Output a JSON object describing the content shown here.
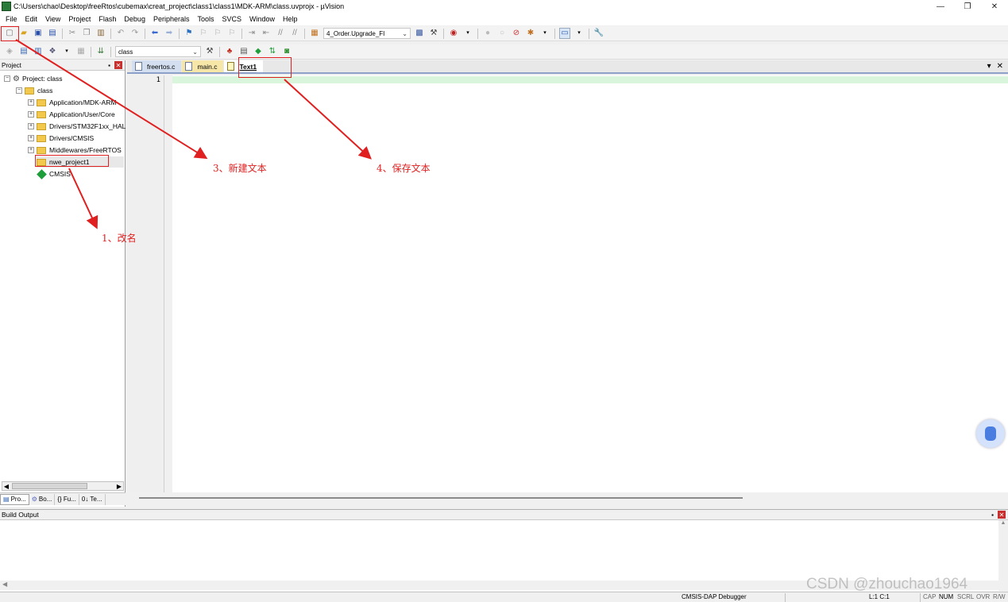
{
  "window": {
    "title": "C:\\Users\\chao\\Desktop\\freeRtos\\cubemax\\creat_project\\class1\\class1\\MDK-ARM\\class.uvprojx - µVision",
    "minimize": "—",
    "maximize": "❐",
    "close": "✕"
  },
  "menu": [
    "File",
    "Edit",
    "View",
    "Project",
    "Flash",
    "Debug",
    "Peripherals",
    "Tools",
    "SVCS",
    "Window",
    "Help"
  ],
  "toolbar": {
    "find_combo": "4_Order.Upgrade_FI",
    "target_combo": "class"
  },
  "project_panel": {
    "title": "Project",
    "tree": [
      {
        "label": "Project: class"
      },
      {
        "label": "class"
      },
      {
        "label": "Application/MDK-ARM"
      },
      {
        "label": "Application/User/Core"
      },
      {
        "label": "Drivers/STM32F1xx_HAL"
      },
      {
        "label": "Drivers/CMSIS"
      },
      {
        "label": "Middlewares/FreeRTOS"
      },
      {
        "label": "nwe_project1"
      },
      {
        "label": "CMSIS"
      }
    ],
    "tabs": [
      "Pro...",
      "Bo...",
      "{} Fu...",
      "0↓ Te..."
    ]
  },
  "editor": {
    "tabs": [
      {
        "label": "freertos.c"
      },
      {
        "label": "main.c"
      },
      {
        "label": "Text1"
      }
    ],
    "line_number": "1"
  },
  "build_output": {
    "title": "Build Output"
  },
  "status": {
    "debugger": "CMSIS-DAP Debugger",
    "position": "L:1 C:1",
    "cap": "CAP",
    "num": "NUM",
    "scrl": "SCRL",
    "ovr": "OVR",
    "rw": "R/W"
  },
  "annotations": {
    "rename": "1、改名",
    "new_text": "3、新建文本",
    "save_text": "4、保存文本",
    "color": "#e02020"
  },
  "watermark": "CSDN @zhouchao1964"
}
